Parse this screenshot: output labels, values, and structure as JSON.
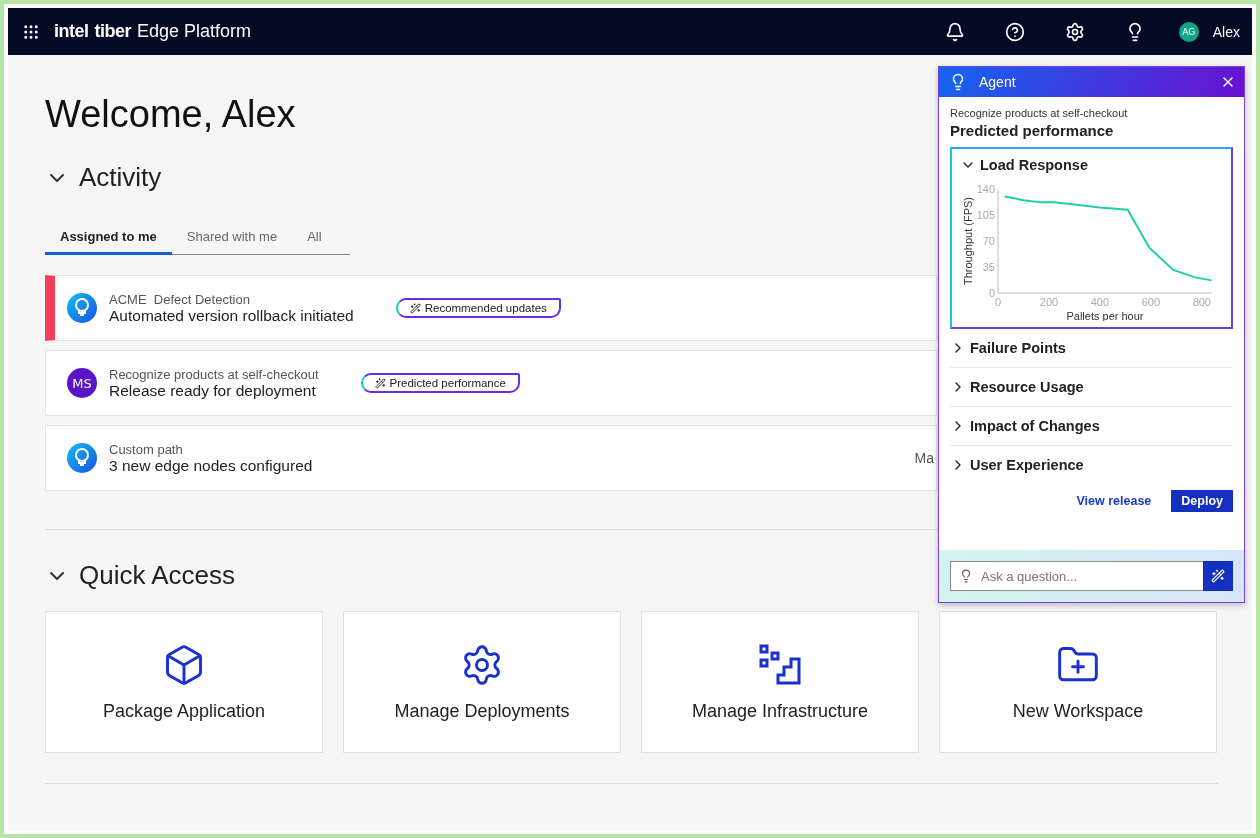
{
  "topbar": {
    "logo": [
      "intel",
      "tiber"
    ],
    "product": "Edge Platform",
    "user": {
      "initials": "AG",
      "name": "Alex"
    }
  },
  "welcome": "Welcome, Alex",
  "activity": {
    "title": "Activity",
    "expanded": true,
    "tabs": [
      {
        "label": "Assigned to me",
        "selected": true
      },
      {
        "label": "Shared with me",
        "selected": false
      },
      {
        "label": "All",
        "selected": false
      }
    ],
    "rows": [
      {
        "kind": "agent",
        "alert": true,
        "project": "ACME  Defect Detection",
        "message": "Automated version rollback initiated",
        "badge": "Recommended updates"
      },
      {
        "kind": "avatar",
        "initials": "MS",
        "alert": false,
        "project": "Recognize products at self-checkout",
        "message": "Release ready for deployment",
        "badge": "Predicted performance"
      },
      {
        "kind": "agent",
        "alert": false,
        "project": "Custom path",
        "message": "3 new edge nodes configured",
        "trailing": "Ma"
      }
    ]
  },
  "quick_access": {
    "title": "Quick Access",
    "expanded": true,
    "cards": [
      {
        "kind": "package",
        "label": "Package Application"
      },
      {
        "kind": "deploy",
        "label": "Manage Deployments"
      },
      {
        "kind": "infra",
        "label": "Manage Infrastructure"
      },
      {
        "kind": "workspace",
        "label": "New Workspace"
      }
    ]
  },
  "agent": {
    "title": "Agent",
    "context": "Recognize products at self-checkout",
    "heading": "Predicted performance",
    "sections": [
      {
        "label": "Load Response",
        "expanded": true,
        "chart_data": {
          "type": "line",
          "xlabel": "Pallets per hour",
          "ylabel": "Throughput (FPS)",
          "xlim": [
            0,
            840
          ],
          "ylim": [
            0,
            140
          ],
          "xticks": [
            0,
            200,
            400,
            600,
            800
          ],
          "yticks": [
            0,
            35,
            70,
            105,
            140
          ],
          "series": [
            {
              "color": "#1ed0a8",
              "x": [
                26,
                100,
                170,
                218,
                300,
                400,
                509,
                594,
                688,
                774,
                838
              ],
              "values": [
                130,
                125,
                122,
                122,
                119,
                115,
                112,
                61,
                31,
                21,
                17
              ]
            }
          ]
        }
      },
      {
        "label": "Failure Points",
        "expanded": false
      },
      {
        "label": "Resource Usage",
        "expanded": false
      },
      {
        "label": "Impact of Changes",
        "expanded": false
      },
      {
        "label": "User Experience",
        "expanded": false
      }
    ],
    "link": "View release",
    "button": "Deploy",
    "input": {
      "placeholder": "Ask a question..."
    }
  }
}
